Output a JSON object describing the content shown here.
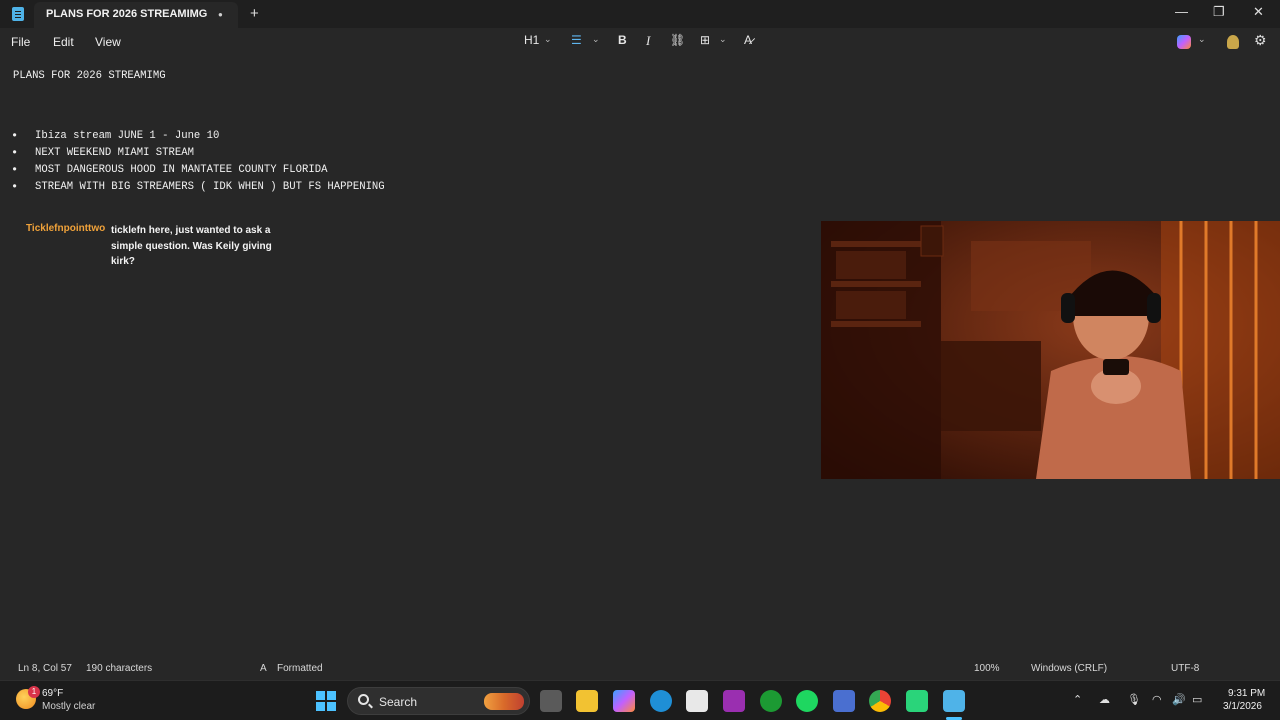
{
  "window": {
    "tab_title": "PLANS FOR 2026 STREAMIMG",
    "unsaved_dot": "●",
    "new_tab": "+",
    "minimize": "—",
    "maximize": "❐",
    "close": "✕"
  },
  "menu": {
    "file": "File",
    "edit": "Edit",
    "view": "View"
  },
  "toolbar": {
    "heading": "H1",
    "list": "☰",
    "bold": "B",
    "italic": "I",
    "link": "⛓",
    "table": "⊞",
    "clear_format": "A̷",
    "chevron": "⌄"
  },
  "document": {
    "title": "PLANS FOR 2026 STREAMIMG",
    "bullet": "•",
    "items": [
      "Ibiza stream JUNE 1 - June 10",
      "NEXT WEEKEND MIAMI STREAM",
      "MOST DANGEROUS HOOD IN MANTATEE COUNTY FLORIDA",
      "STREAM WITH BIG STREAMERS ( IDK WHEN ) BUT FS HAPPENING"
    ]
  },
  "chat": {
    "username": "Ticklefnpointtwo",
    "message": "ticklefn here, just wanted to ask a simple question. Was Keily giving kirk?"
  },
  "status": {
    "position": "Ln 8, Col 57",
    "characters": "190 characters",
    "format": "Formatted",
    "zoom": "100%",
    "line_ending": "Windows (CRLF)",
    "encoding": "UTF-8"
  },
  "taskbar": {
    "weather_temp": "69°F",
    "weather_desc": "Mostly clear",
    "weather_badge": "1",
    "search_label": "Search",
    "time": "9:31 PM",
    "date": "3/1/2026"
  },
  "colors": {
    "accent": "#4fb3e8",
    "chat_username": "#f0a23a",
    "background": "#272727"
  }
}
